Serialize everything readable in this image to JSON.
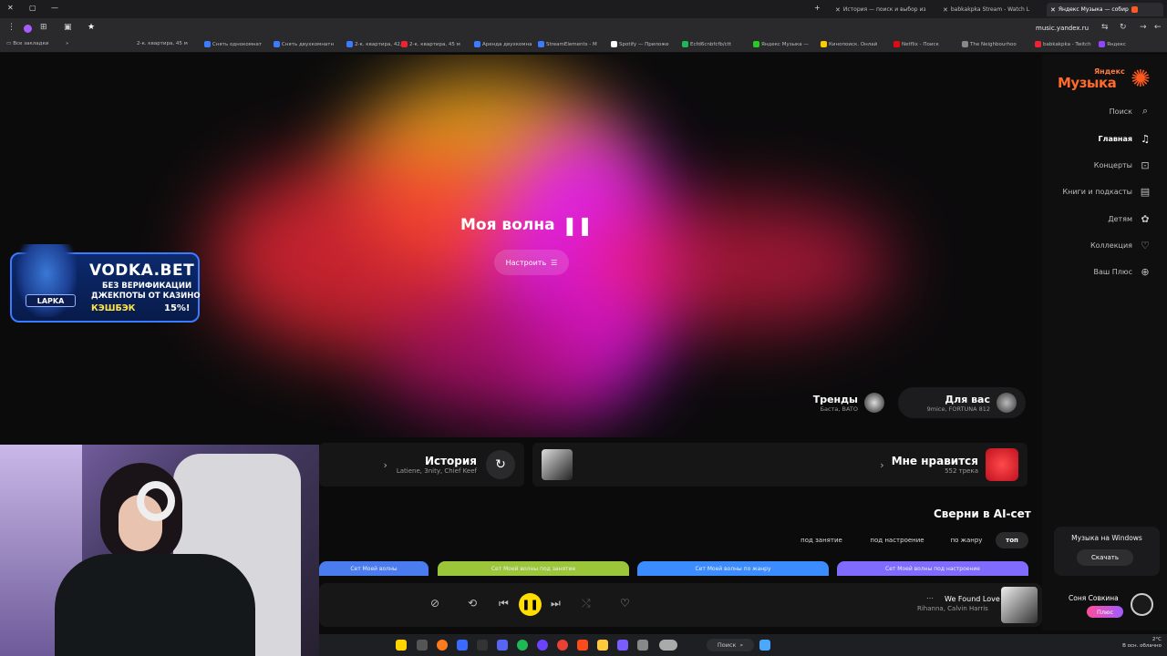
{
  "browser": {
    "tabs": [
      {
        "label": "Яндекс Музыка — собир",
        "active": true
      },
      {
        "label": "babkakpka Stream - Watch L"
      },
      {
        "label": "История — поиск и выбор из"
      }
    ],
    "url": "music.yandex.ru",
    "bookmarks": [
      "Все закладки",
      "2-к. квартира, 45 м",
      "Снять однокомнат",
      "Снять двухкомнатн",
      "2-к. квартира, 42,9",
      "2-к. квартира, 45 м",
      "Аренда двухкомна",
      "Снять двухкомнатн",
      "StreamElements - M",
      "Spotify — Приложе",
      "Ecfd6cnbfcfb/ctt",
      "Яндекс Музыка —",
      "Кинопоиск. Онлай",
      "Netflix - Поиск",
      "The Neighbourhoo",
      "babkakpka - Twitch",
      "Яндекс"
    ]
  },
  "app": {
    "logo_small": "Яндекс",
    "logo_main": "Музыка",
    "sidebar": [
      {
        "label": "Поиск",
        "icon": "search-icon"
      },
      {
        "label": "Главная",
        "icon": "headphones-icon",
        "active": true
      },
      {
        "label": "Концерты",
        "icon": "ticket-icon"
      },
      {
        "label": "Книги и подкасты",
        "icon": "book-icon"
      },
      {
        "label": "Детям",
        "icon": "kids-icon"
      },
      {
        "label": "Коллекция",
        "icon": "heart-icon"
      },
      {
        "label": "Ваш Плюс",
        "icon": "plus-icon"
      }
    ],
    "promo": {
      "title": "Музыка на Windows",
      "button": "Скачать"
    },
    "user": {
      "name": "Соня Совкина",
      "badge": "Плюс"
    }
  },
  "hero": {
    "title": "Моя волна",
    "tune_button": "Настроить"
  },
  "chips": [
    {
      "title": "Для вас",
      "subtitle": "9mice, FORTUNA 812"
    },
    {
      "title": "Тренды",
      "subtitle": "Баста, BATO"
    }
  ],
  "cards": [
    {
      "title": "Мне нравится",
      "subtitle": "552 трека"
    },
    {
      "title": "История",
      "subtitle": "Latiene, 3nity, Chief Keef"
    }
  ],
  "sets": {
    "title": "Сверни в AI-сет",
    "filters": [
      "топ",
      "по жанру",
      "под настроение",
      "под занятие"
    ],
    "cards": [
      "Сет Моей волны под настроение",
      "Сет Моей волны по жанру",
      "Сет Моей волны под занятие",
      "Сет Моей волны"
    ]
  },
  "player": {
    "track": "We Found Love",
    "artist": "Rihanna, Calvin Harris"
  },
  "taskbar": {
    "search": "Поиск",
    "temp": "2°C",
    "weather": "В осн. облачно"
  },
  "ad": {
    "brand": "VODKA.BET",
    "line1": "БЕЗ ВЕРИФИКАЦИИ",
    "line2": "ДЖЕКПОТЫ ОТ КАЗИНО",
    "line3": "КЭШБЭК",
    "line4": "15%!",
    "name": "LAPKA"
  },
  "colors": {
    "accent_yellow": "#ffdd00",
    "logo_orange": "#ff6a2c",
    "plus_pink": "#ff4c9a"
  }
}
